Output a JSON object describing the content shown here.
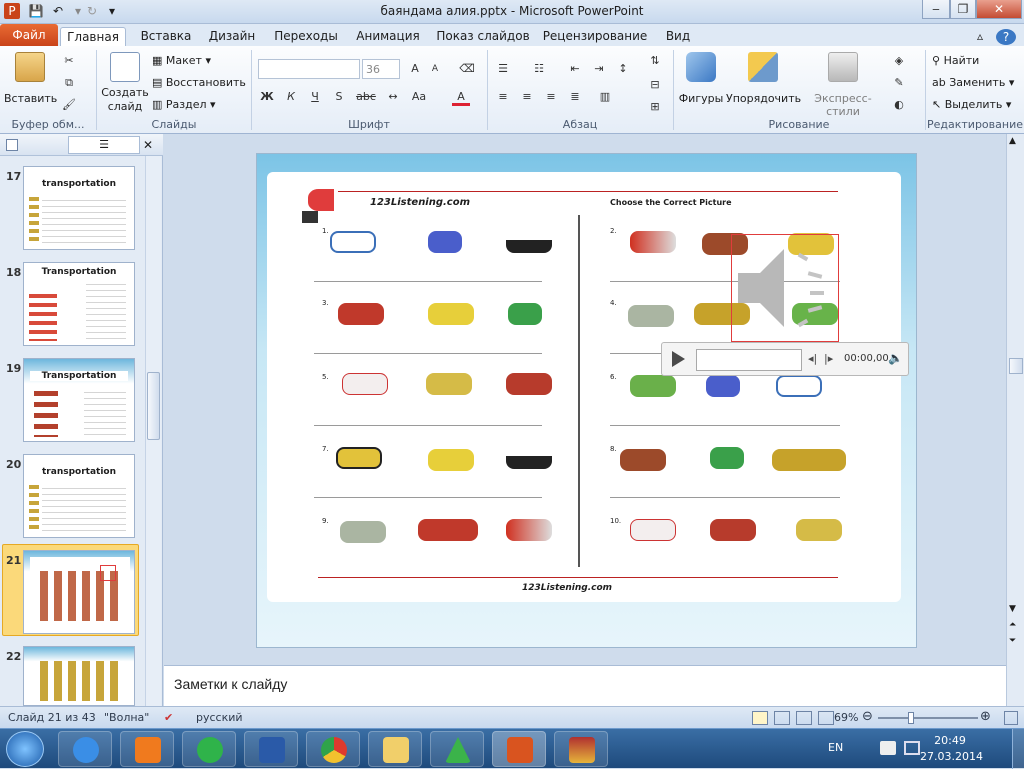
{
  "window": {
    "title": "баяндама алия.pptx - Microsoft PowerPoint"
  },
  "tabs": {
    "file": "Файл",
    "items": [
      "Главная",
      "Вставка",
      "Дизайн",
      "Переходы",
      "Анимация",
      "Показ слайдов",
      "Рецензирование",
      "Вид"
    ]
  },
  "ribbon": {
    "clipboard": {
      "paste": "Вставить",
      "label": "Буфер обм..."
    },
    "slides": {
      "new_slide_1": "Создать",
      "new_slide_2": "слайд",
      "layout": "Макет",
      "reset": "Восстановить",
      "section": "Раздел",
      "label": "Слайды"
    },
    "font": {
      "size": "36",
      "label": "Шрифт"
    },
    "paragraph": {
      "label": "Абзац"
    },
    "drawing": {
      "shapes": "Фигуры",
      "arrange": "Упорядочить",
      "styles": "Экспресс-стили",
      "label": "Рисование"
    },
    "editing": {
      "find": "Найти",
      "replace": "Заменить",
      "select": "Выделить",
      "label": "Редактирование"
    }
  },
  "thumbnails": [
    {
      "num": "17",
      "title": "transportation"
    },
    {
      "num": "18",
      "title": "Transportation"
    },
    {
      "num": "19",
      "title": "Transportation"
    },
    {
      "num": "20",
      "title": "transportation"
    },
    {
      "num": "21",
      "title": ""
    },
    {
      "num": "22",
      "title": ""
    }
  ],
  "slide": {
    "site": "123Listening.com",
    "heading": "Choose the Correct Picture",
    "questions": [
      "1.",
      "2.",
      "3.",
      "4.",
      "5.",
      "6.",
      "7.",
      "8.",
      "9.",
      "10."
    ],
    "footer": "123Listening.com"
  },
  "media": {
    "time": "00:00,00"
  },
  "notes": {
    "placeholder": "Заметки к слайду"
  },
  "status": {
    "slide": "Слайд 21 из 43",
    "theme": "\"Волна\"",
    "lang": "русский",
    "zoom": "69%"
  },
  "taskbar": {
    "lang": "EN",
    "time": "20:49",
    "date": "27.03.2014"
  },
  "colors": {
    "file_tab": "#d9541f",
    "ribbon_bg": "#e5edf7",
    "slide_bg": "#7cc4e6",
    "selection": "#e03c3c"
  }
}
